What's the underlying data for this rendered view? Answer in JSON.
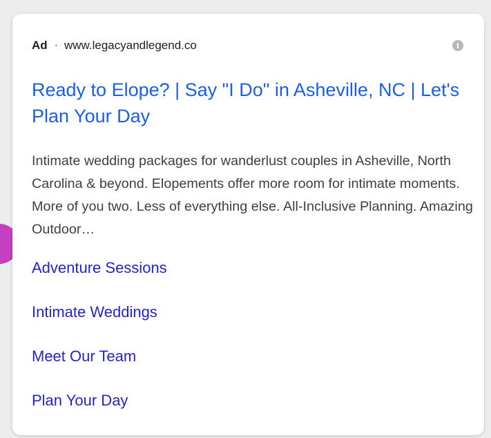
{
  "ad": {
    "label": "Ad",
    "separator": "·",
    "display_url": "www.legacyandlegend.co",
    "info_icon": "info-icon",
    "info_glyph": "i",
    "title": "Ready to Elope? | Say \"I Do\" in Asheville, NC | Let's Plan Your Day",
    "description": "Intimate wedding packages for wanderlust couples in Asheville, North Carolina & beyond. Elopements offer more room for intimate moments. More of you two. Less of everything else. All-Inclusive Planning. Amazing Outdoor…",
    "sitelinks": [
      {
        "label": "Adventure Sessions"
      },
      {
        "label": "Intimate Weddings"
      },
      {
        "label": "Meet Our Team"
      },
      {
        "label": "Plan Your Day"
      }
    ]
  },
  "colors": {
    "title_link": "#1a5ee8",
    "sitelink": "#2424c8",
    "description_text": "#3c4043",
    "background": "#ececec",
    "pointer_accent": "#c43fc0"
  }
}
